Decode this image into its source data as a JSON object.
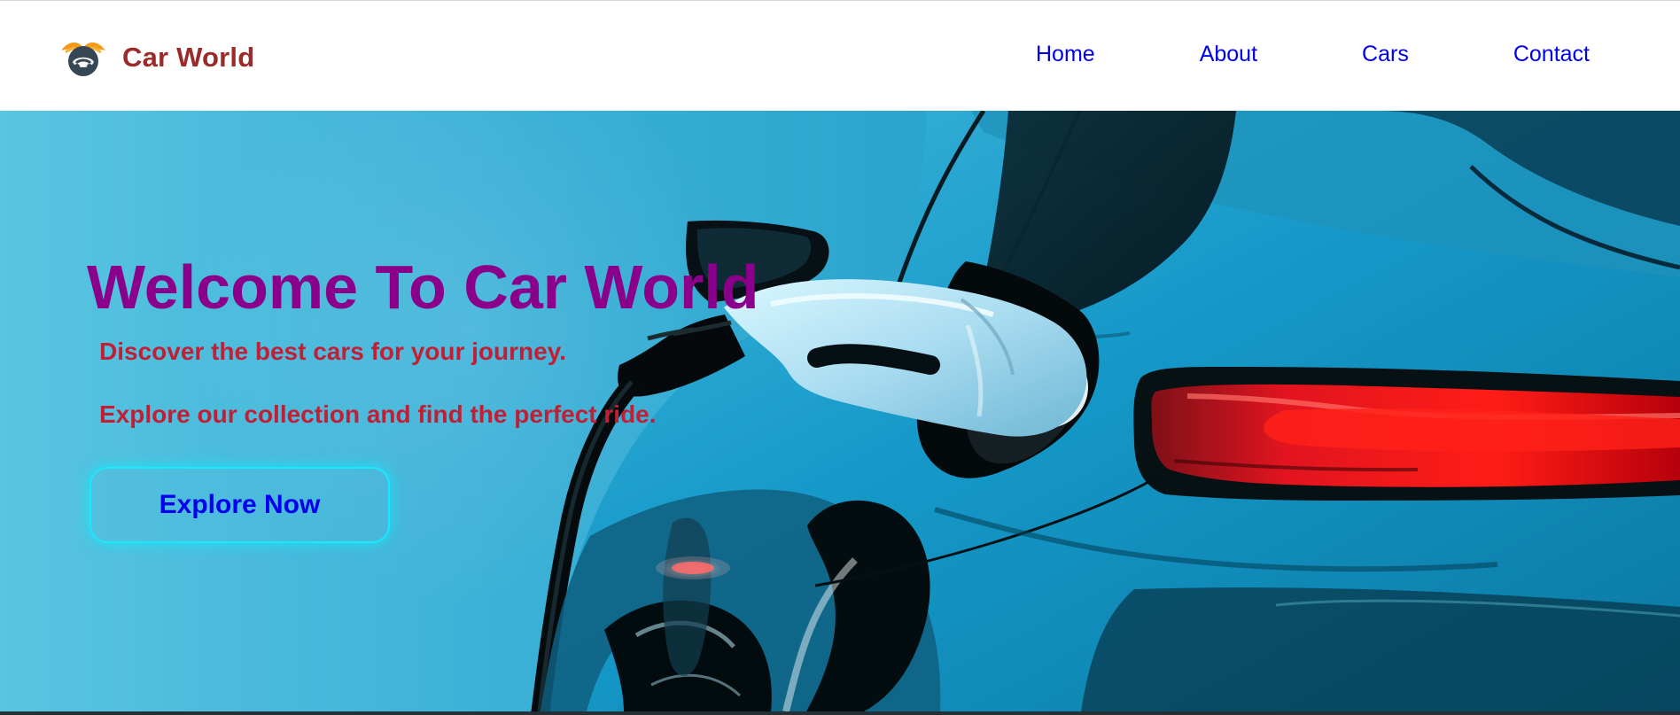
{
  "brand": {
    "name": "Car World",
    "logo_icon": "car-wings-logo-icon"
  },
  "nav": {
    "items": [
      {
        "label": "Home"
      },
      {
        "label": "About"
      },
      {
        "label": "Cars"
      },
      {
        "label": "Contact"
      }
    ]
  },
  "hero": {
    "title": "Welcome To Car World",
    "subtitle": "Discover the best cars for your journey.",
    "text": "Explore our collection and find the perfect ride.",
    "button_label": "Explore Now",
    "image_icon": "electric-car-charging-icon"
  },
  "colors": {
    "brand": "#9b2a2a",
    "nav_link": "#0000ee",
    "hero_title": "#8b008b",
    "hero_text": "#c11f36",
    "button_outline": "#1de7ff"
  }
}
